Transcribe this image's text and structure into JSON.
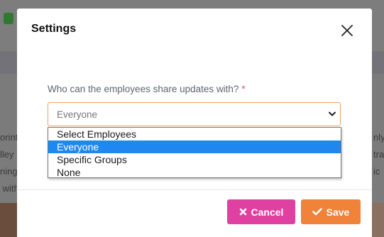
{
  "background": {
    "left_text_lines": [
      "orint",
      "lley ",
      "ning ",
      " with"
    ],
    "right_text_lines": [
      "",
      "nly",
      "tras",
      "ic"
    ]
  },
  "modal": {
    "title": "Settings",
    "close_icon": "close-icon",
    "field": {
      "label": "Who can the employees share updates with?",
      "required_marker": "*",
      "selected_value": "Everyone",
      "options": [
        "Select Employees",
        "Everyone",
        "Specific Groups",
        "None"
      ],
      "highlighted_option": "Everyone"
    },
    "footer": {
      "cancel_label": "Cancel",
      "cancel_icon": "x-icon",
      "save_label": "Save",
      "save_icon": "check-icon"
    }
  },
  "colors": {
    "cancel_button": "#e040a0",
    "save_button": "#f0823a",
    "select_border": "#e9a06b",
    "option_highlight": "#1e88f0",
    "required_star": "#e0525b"
  }
}
